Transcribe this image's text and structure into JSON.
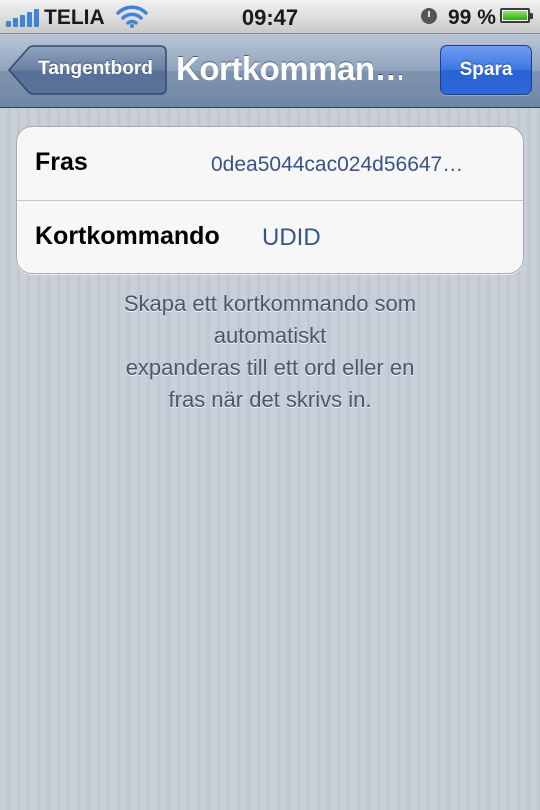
{
  "status_bar": {
    "carrier": "TELIA",
    "time": "09:47",
    "battery_percent": "99 %",
    "battery_level": 0.99,
    "signal_bars": 5,
    "icons": [
      "signal-icon",
      "wifi-icon",
      "alarm-clock-icon",
      "battery-icon"
    ],
    "battery_color": "#2faa12",
    "signal_color": "#3f84d4"
  },
  "nav": {
    "back_label": "Tangentbord",
    "title": "Kortkomman…",
    "save_label": "Spara",
    "save_color": "#2c68d8"
  },
  "form": {
    "phrase_label": "Fras",
    "phrase_value": "0dea5044cac024d56647…",
    "shortcut_label": "Kortkommando",
    "shortcut_value": "UDID",
    "value_color": "#385487"
  },
  "footer": {
    "lines": [
      "Skapa ett kortkommando som",
      "automatiskt",
      "expanderas till ett ord eller en",
      "fras när det skrivs in."
    ]
  }
}
